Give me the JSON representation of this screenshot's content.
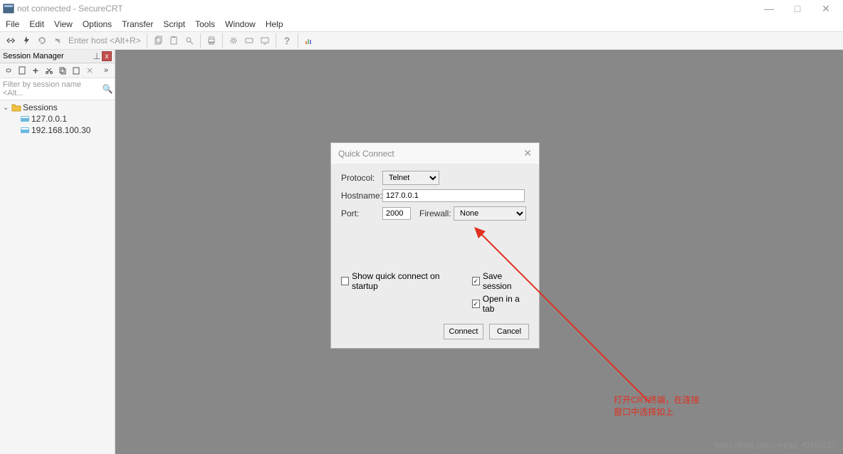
{
  "window": {
    "title": "not connected - SecureCRT",
    "controls": {
      "minimize": "—",
      "maximize": "□",
      "close": "✕"
    }
  },
  "menubar": [
    "File",
    "Edit",
    "View",
    "Options",
    "Transfer",
    "Script",
    "Tools",
    "Window",
    "Help"
  ],
  "toolbar": {
    "host_placeholder": "Enter host <Alt+R>"
  },
  "sidebar": {
    "title": "Session Manager",
    "filter_placeholder": "Filter by session name <Alt...",
    "root": "Sessions",
    "items": [
      "127.0.0.1",
      "192.168.100.30"
    ]
  },
  "dialog": {
    "title": "Quick Connect",
    "protocol_label": "Protocol:",
    "protocol_value": "Telnet",
    "hostname_label": "Hostname:",
    "hostname_value": "127.0.0.1",
    "port_label": "Port:",
    "port_value": "2000",
    "firewall_label": "Firewall:",
    "firewall_value": "None",
    "show_startup": "Show quick connect on startup",
    "save_session": "Save session",
    "open_tab": "Open in a tab",
    "connect": "Connect",
    "cancel": "Cancel"
  },
  "annotation": {
    "line1": "打开CRT终端，在连接",
    "line2": "窗口中选择如上"
  },
  "watermark": "https://blog.csdn.net/qq_42761527"
}
